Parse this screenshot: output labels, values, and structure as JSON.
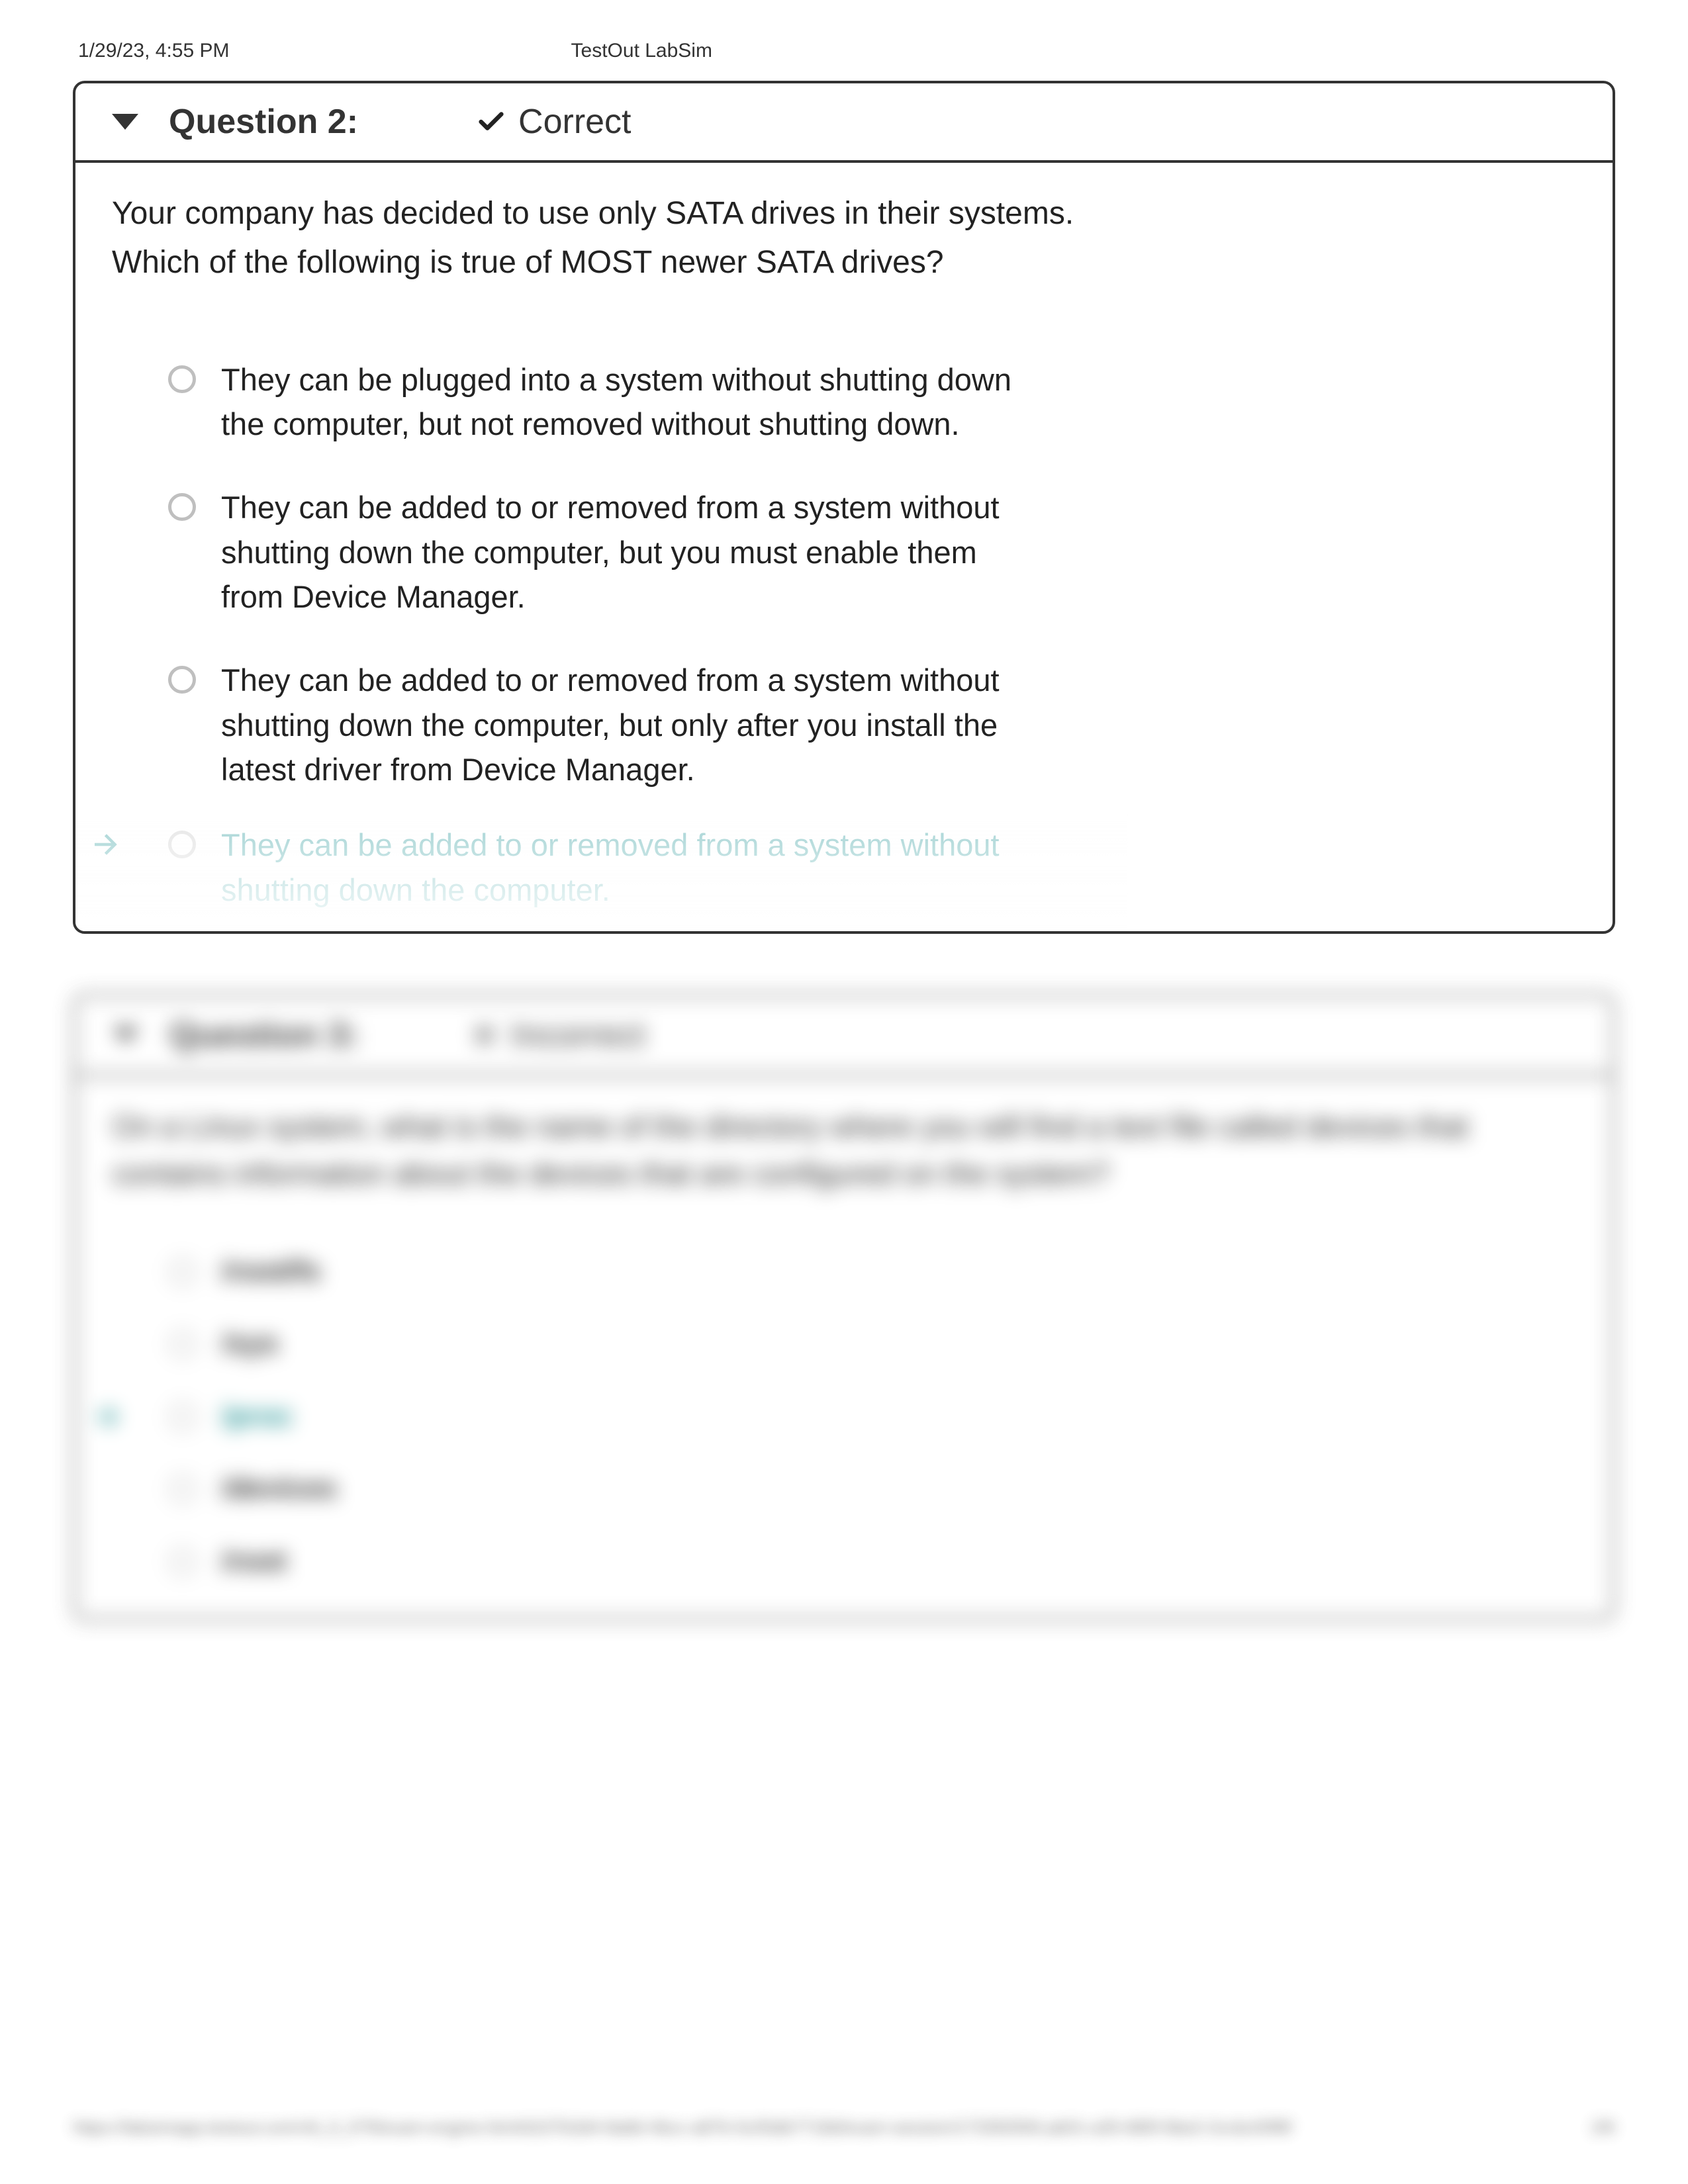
{
  "header": {
    "timestamp": "1/29/23, 4:55 PM",
    "title": "TestOut LabSim"
  },
  "question2": {
    "label": "Question 2:",
    "status": "Correct",
    "prompt_line1": "Your company has decided to use only SATA drives in their systems.",
    "prompt_line2": "Which of the following is true of MOST newer SATA drives?",
    "options": [
      {
        "text": "They can be plugged into a system without shutting down the computer, but not removed without shutting down.",
        "selected": false,
        "correct": false
      },
      {
        "text": "They can be added to or removed from a system without shutting down the computer, but you must enable them from Device Manager.",
        "selected": false,
        "correct": false
      },
      {
        "text": "They can be added to or removed from a system without shutting down the computer, but only after you install the latest driver from Device Manager.",
        "selected": false,
        "correct": false
      },
      {
        "text": "They can be added to or removed from a system without shutting down the computer.",
        "selected": true,
        "correct": true
      }
    ]
  },
  "question3_blurred": {
    "label": "Question 3:",
    "status": "Incorrect",
    "prompt": "On a Linux system, what is the name of the directory where you will find a text file called devices that contains information about the devices that are configured on the system?",
    "options": [
      {
        "text": "/root/fs"
      },
      {
        "text": "/sys"
      },
      {
        "text": "/proc",
        "marked": true
      },
      {
        "text": "/devices"
      },
      {
        "text": "/root"
      }
    ]
  },
  "footer": {
    "url": "https://labsimapp.testout.com/v6_0_579/exam-engine.html/d107b3d4-8a8d-4bcc-a87b-5c05db7718d/exam-session/17335059/Lab01-a35-685f-6be2-2ccbc00f6f",
    "page": "2/6"
  }
}
